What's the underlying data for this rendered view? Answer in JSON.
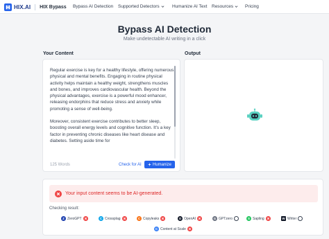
{
  "nav": {
    "logo_text": "HIX.AI",
    "logo_sub": "HIX Bypass",
    "items": [
      {
        "label": "Bypass AI Detection"
      },
      {
        "label": "Supported Detectors"
      },
      {
        "label": "Humanize AI Text"
      },
      {
        "label": "Resources"
      },
      {
        "label": "Pricing"
      }
    ]
  },
  "header": {
    "title": "Bypass AI Detection",
    "subtitle": "Make undetectable AI writing in a click"
  },
  "input_panel": {
    "label": "Your Content",
    "paragraphs": [
      "Regular exercise is key for a healthy lifestyle, offering numerous physical and mental benefits. Engaging in routine physical activity helps maintain a healthy weight, strengthens muscles and bones, and improves cardiovascular health. Beyond the physical advantages, exercise is a powerful mood enhancer, releasing endorphins that reduce stress and anxiety while promoting a sense of well-being.",
      "Moreover, consistent exercise contributes to better sleep, boosting overall energy levels and cognitive function. It's a key factor in preventing chronic diseases like heart disease and diabetes. Setting aside time for"
    ],
    "word_count": "125 Words",
    "check_label": "Check for AI",
    "humanize_label": "Humanize"
  },
  "output_panel": {
    "label": "Output"
  },
  "result": {
    "alert": "Your input content seems to be AI-generated.",
    "checking_label": "Checking result:",
    "detectors": [
      {
        "name": "ZeroGPT",
        "status": "fail"
      },
      {
        "name": "Crossplag",
        "status": "fail"
      },
      {
        "name": "Copyleaks",
        "status": "fail"
      },
      {
        "name": "OpenAI",
        "status": "fail"
      },
      {
        "name": "GPTzero",
        "status": "pending"
      },
      {
        "name": "Sapling",
        "status": "fail"
      },
      {
        "name": "Writer",
        "status": "pending"
      },
      {
        "name": "Content at Scale",
        "status": "fail"
      }
    ]
  },
  "colors": {
    "accent": "#2563eb",
    "alert_bg": "#fdecec",
    "alert_text": "#dc2626",
    "bot": "#5ad1c1"
  }
}
